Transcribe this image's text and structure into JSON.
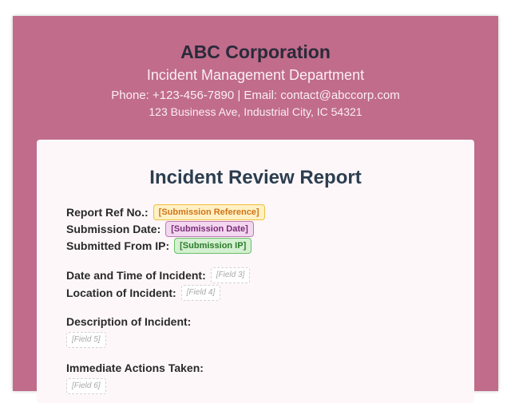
{
  "letterhead": {
    "company": "ABC Corporation",
    "department": "Incident Management Department",
    "contact": "Phone: +123-456-7890 | Email: contact@abccorp.com",
    "address": "123 Business Ave, Industrial City, IC 54321"
  },
  "report": {
    "title": "Incident Review Report",
    "meta": {
      "ref_label": "Report Ref No.:",
      "ref_value": "[Submission Reference]",
      "date_label": "Submission Date:",
      "date_value": "[Submission Date]",
      "ip_label": "Submitted From IP:",
      "ip_value": "[Submission IP]"
    },
    "datetime_label": "Date and Time of Incident:",
    "datetime_value": "[Field 3]",
    "location_label": "Location of Incident:",
    "location_value": "[Field 4]",
    "description_label": "Description of Incident:",
    "description_value": "[Field 5]",
    "actions_label": "Immediate Actions Taken:",
    "actions_value": "[Field 6]"
  },
  "colors": {
    "page_background": "#c06c8a",
    "card_background": "#fdf7f9",
    "title_color": "#2c3e50"
  }
}
